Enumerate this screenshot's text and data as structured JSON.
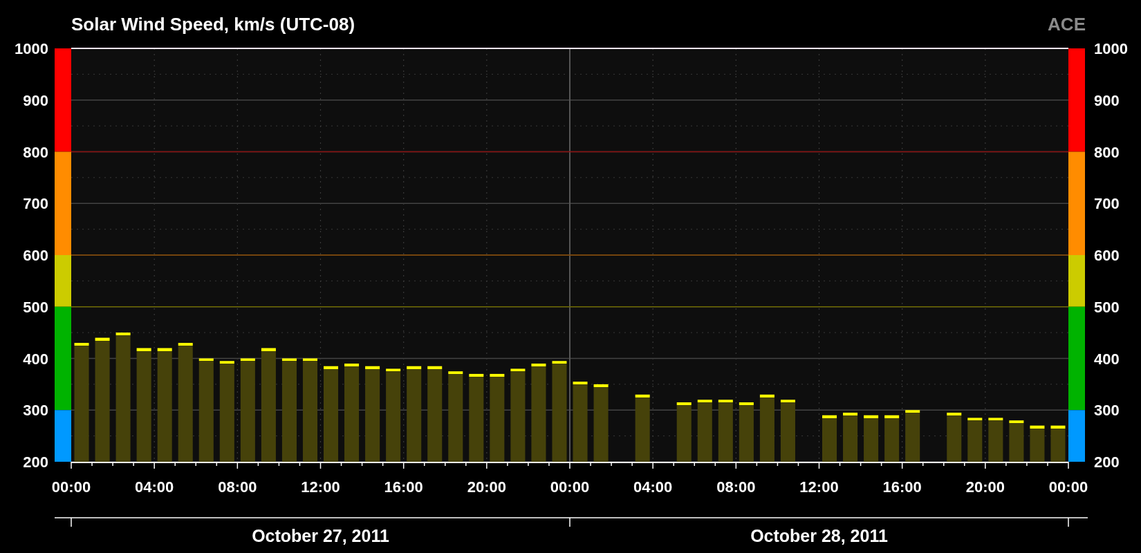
{
  "title": "Solar Wind Speed, km/s (UTC-08)",
  "source": "ACE",
  "chart": {
    "chart_data": {
      "type": "bar",
      "x": [
        "2011-10-27T00:30",
        "2011-10-27T01:30",
        "2011-10-27T02:30",
        "2011-10-27T03:30",
        "2011-10-27T04:30",
        "2011-10-27T05:30",
        "2011-10-27T06:30",
        "2011-10-27T07:30",
        "2011-10-27T08:30",
        "2011-10-27T09:30",
        "2011-10-27T10:30",
        "2011-10-27T11:30",
        "2011-10-27T12:30",
        "2011-10-27T13:30",
        "2011-10-27T14:30",
        "2011-10-27T15:30",
        "2011-10-27T16:30",
        "2011-10-27T17:30",
        "2011-10-27T18:30",
        "2011-10-27T19:30",
        "2011-10-27T20:30",
        "2011-10-27T21:30",
        "2011-10-27T22:30",
        "2011-10-27T23:30",
        "2011-10-28T00:30",
        "2011-10-28T01:30",
        "2011-10-28T03:30",
        "2011-10-28T05:30",
        "2011-10-28T06:30",
        "2011-10-28T07:30",
        "2011-10-28T08:30",
        "2011-10-28T09:30",
        "2011-10-28T10:30",
        "2011-10-28T12:30",
        "2011-10-28T13:30",
        "2011-10-28T14:30",
        "2011-10-28T15:30",
        "2011-10-28T16:30",
        "2011-10-28T18:30",
        "2011-10-28T19:30",
        "2011-10-28T20:30",
        "2011-10-28T21:30",
        "2011-10-28T22:30",
        "2011-10-28T23:30"
      ],
      "values": [
        430,
        440,
        450,
        420,
        420,
        430,
        400,
        395,
        400,
        420,
        400,
        400,
        385,
        390,
        385,
        380,
        385,
        385,
        375,
        370,
        370,
        380,
        390,
        395,
        355,
        350,
        330,
        315,
        320,
        320,
        315,
        330,
        320,
        290,
        295,
        290,
        290,
        300,
        295,
        285,
        285,
        280,
        270,
        270
      ],
      "xlim": [
        "2011-10-27T00:00",
        "2011-10-29T00:00"
      ],
      "ylim": [
        200,
        1000
      ],
      "xticks": [
        {
          "value": "2011-10-27T00:00",
          "label": "00:00"
        },
        {
          "value": "2011-10-27T04:00",
          "label": "04:00"
        },
        {
          "value": "2011-10-27T08:00",
          "label": "08:00"
        },
        {
          "value": "2011-10-27T12:00",
          "label": "12:00"
        },
        {
          "value": "2011-10-27T16:00",
          "label": "16:00"
        },
        {
          "value": "2011-10-27T20:00",
          "label": "20:00"
        },
        {
          "value": "2011-10-28T00:00",
          "label": "00:00"
        },
        {
          "value": "2011-10-28T04:00",
          "label": "04:00"
        },
        {
          "value": "2011-10-28T08:00",
          "label": "08:00"
        },
        {
          "value": "2011-10-28T12:00",
          "label": "12:00"
        },
        {
          "value": "2011-10-28T16:00",
          "label": "16:00"
        },
        {
          "value": "2011-10-28T20:00",
          "label": "20:00"
        },
        {
          "value": "2011-10-29T00:00",
          "label": "00:00"
        }
      ],
      "yticks": [
        200,
        300,
        400,
        500,
        600,
        700,
        800,
        900,
        1000
      ],
      "grid": true,
      "ref_lines": [
        {
          "axis": "x",
          "value": "2011-10-28T00:00",
          "color": "#555555"
        },
        {
          "axis": "y",
          "value": 500,
          "color": "#6b6600"
        },
        {
          "axis": "y",
          "value": 600,
          "color": "#8a4a00"
        },
        {
          "axis": "y",
          "value": 800,
          "color": "#8a1010"
        }
      ]
    },
    "speed_scale": [
      {
        "color": "#ff0000"
      },
      {
        "color": "#ff8c00"
      },
      {
        "color": "#cccc00"
      },
      {
        "color": "#00b300"
      },
      {
        "color": "#0099ff"
      }
    ],
    "right_axis_labels": [
      "1000",
      "900",
      "800",
      "700",
      "600",
      "500",
      "400",
      "300",
      "200"
    ],
    "dates": [
      "October 27, 2011",
      "October 28, 2011"
    ]
  }
}
